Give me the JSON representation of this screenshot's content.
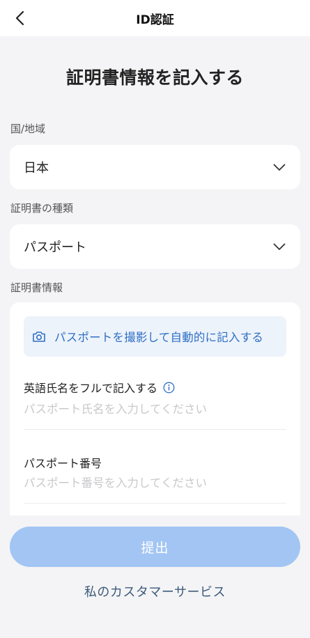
{
  "nav": {
    "title": "ID認証"
  },
  "page": {
    "title": "証明書情報を記入する"
  },
  "country": {
    "label": "国/地域",
    "value": "日本"
  },
  "document_type": {
    "label": "証明書の種類",
    "value": "パスポート"
  },
  "document_info": {
    "label": "証明書情報",
    "scan_text": "パスポートを撮影して自動的に記入する",
    "full_name": {
      "label": "英語氏名をフルで記入する",
      "value": "",
      "placeholder": "パスポート氏名を入力してください"
    },
    "passport_number": {
      "label": "パスポート番号",
      "value": "",
      "placeholder": "パスポート番号を入力してください"
    }
  },
  "actions": {
    "submit_label": "提出",
    "support_label": "私のカスタマーサービス"
  },
  "colors": {
    "accent": "#2f6fc4",
    "submit_disabled": "#a2c5f3",
    "background": "#f4f4f6"
  }
}
